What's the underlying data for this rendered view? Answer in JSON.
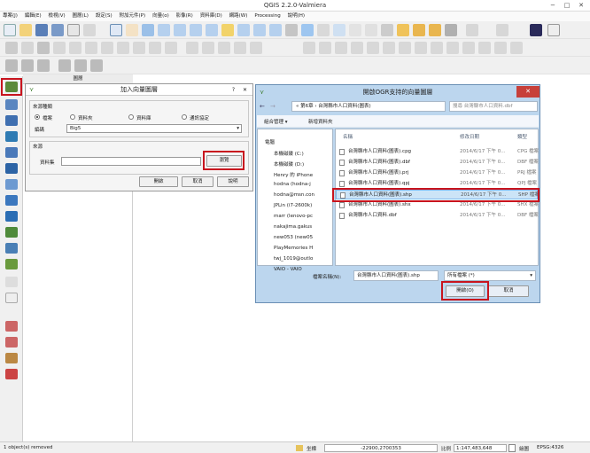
{
  "window": {
    "title": "QGIS 2.2.0-Valmiera",
    "minimize": "−",
    "maximize": "□",
    "close": "✕"
  },
  "menubar": [
    "專案(J)",
    "編輯(E)",
    "檢視(V)",
    "圖層(L)",
    "設定(S)",
    "附加元件(P)",
    "向量(o)",
    "影像(R)",
    "資料庫(D)",
    "網路(W)",
    "Processing",
    "說明(H)"
  ],
  "layers_panel": {
    "title": "圖層"
  },
  "add_vector": {
    "title": "加入向量圖層",
    "help": "?",
    "close": "✕",
    "source_type_group": "來源種類",
    "radios": [
      "檔案",
      "資料夾",
      "資料庫",
      "通訊協定"
    ],
    "encoding_label": "編碼",
    "encoding_value": "Big5",
    "source_group": "來源",
    "dataset_label": "資料集",
    "browse": "瀏覽",
    "open": "開啟",
    "cancel": "取消",
    "help_btn": "說明"
  },
  "open_dialog": {
    "title": "開啟OGR支持的向量圖層",
    "close": "✕",
    "address": "« 第6章 › 台灣縣市人口資料(圖表)",
    "search_placeholder": "搜尋 台灣縣市人口資料.dbf",
    "organize": "組合管理 ▾",
    "new_folder": "新增資料夾",
    "nav": [
      "電腦",
      "本機磁碟 (C:)",
      "本機磁碟 (D:)",
      "Henry 的 iPhone",
      "hodna (hodna-j",
      "hodna@msn.con",
      "JPLin (i7-2600k)",
      "marr (lenovo-pc",
      "nakajima.gakus",
      "new053 (new05",
      "PlayMemories H",
      "twj_1019@outlo",
      "VAIO - VAIO"
    ],
    "columns": {
      "name": "名稱",
      "date": "修改日期",
      "type": "類型"
    },
    "files": [
      {
        "name": "台灣縣市人口資料(圖表).cpg",
        "date": "2014/6/17 下午 0...",
        "type": "CPG 檔案"
      },
      {
        "name": "台灣縣市人口資料(圖表).dbf",
        "date": "2014/6/17 下午 0...",
        "type": "DBF 檔案"
      },
      {
        "name": "台灣縣市人口資料(圖表).prj",
        "date": "2014/6/17 下午 0...",
        "type": "PRJ 檔案"
      },
      {
        "name": "台灣縣市人口資料(圖表).qpj",
        "date": "2014/6/17 下午 0...",
        "type": "QPJ 檔案"
      },
      {
        "name": "台灣縣市人口資料(圖表).shp",
        "date": "2014/6/17 下午 0...",
        "type": "SHP 檔案"
      },
      {
        "name": "台灣縣市人口資料(圖表).shx",
        "date": "2014/6/17 下午 0...",
        "type": "SHX 檔案"
      },
      {
        "name": "台灣縣市人口資料.dbf",
        "date": "2014/6/17 下午 0...",
        "type": "DBF 檔案"
      }
    ],
    "filename_label": "檔案名稱(N):",
    "filename_value": "台灣縣市人口資料(圖表).shp",
    "filter_value": "所有檔案 (*)",
    "open": "開啟(O)",
    "cancel": "取消"
  },
  "statusbar": {
    "message": "1 object(s) removed",
    "coord_label": "坐標",
    "coord_value": "-22900,2700353",
    "scale_label": "比例",
    "scale_value": "1:147,483,648",
    "render_label": "繪圖",
    "crs": "EPSG:4326"
  }
}
